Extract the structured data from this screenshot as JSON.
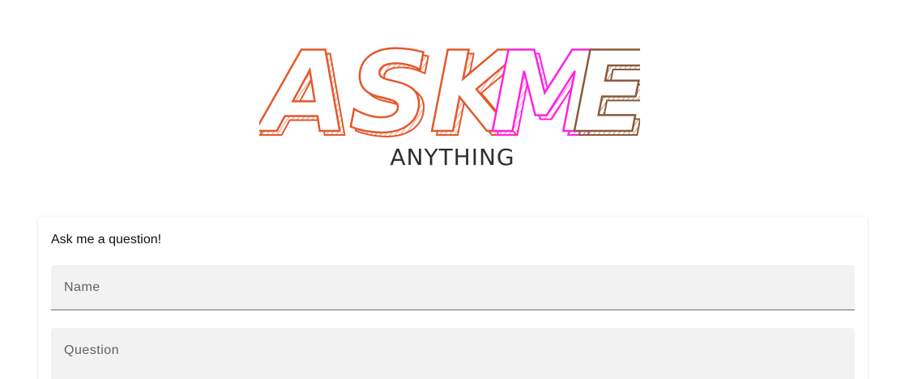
{
  "header": {
    "logo_text": "ASK ME",
    "subtitle": "ANYTHING",
    "colors": {
      "ask": "#e4582b",
      "m": "#ff22e0",
      "e": "#8a5a3a"
    }
  },
  "form": {
    "title": "Ask me a question!",
    "name_placeholder": "Name",
    "question_placeholder": "Question"
  }
}
